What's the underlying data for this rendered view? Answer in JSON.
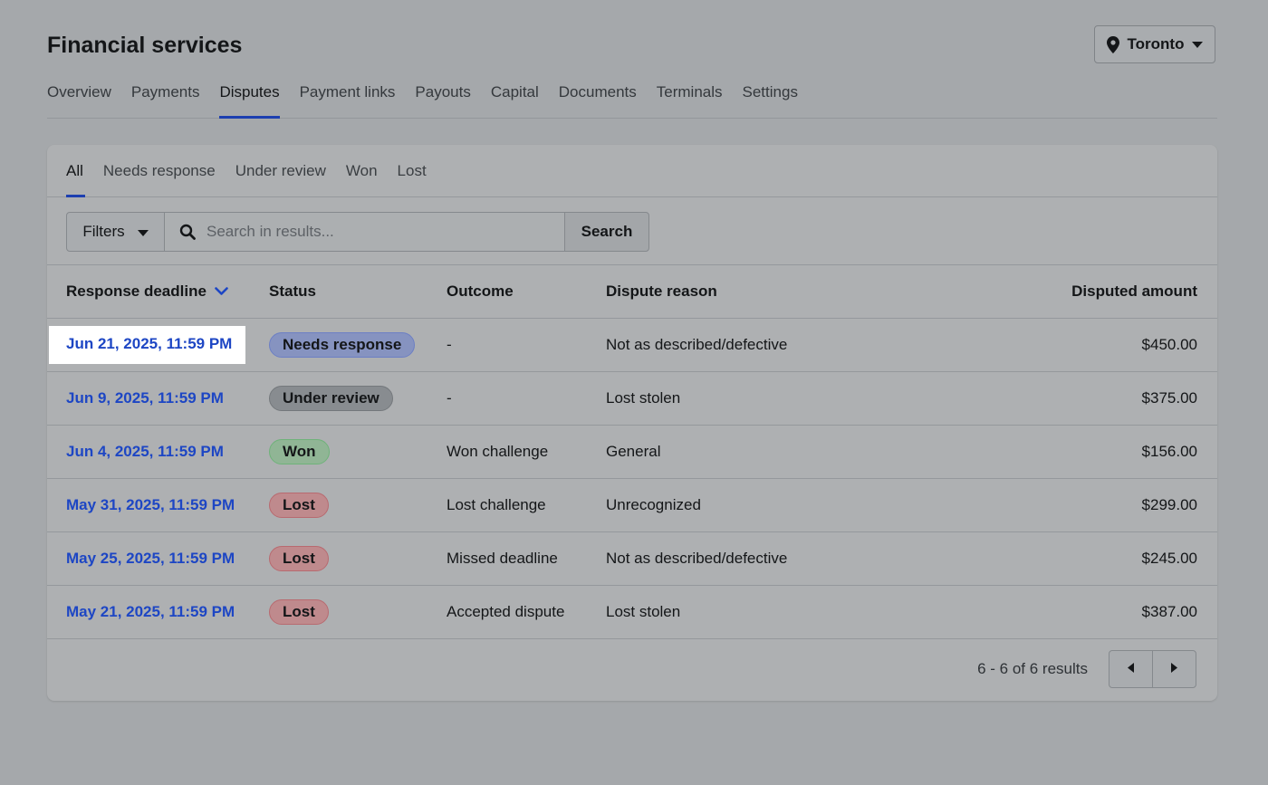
{
  "header": {
    "title": "Financial services",
    "location": "Toronto"
  },
  "nav": {
    "items": [
      "Overview",
      "Payments",
      "Disputes",
      "Payment links",
      "Payouts",
      "Capital",
      "Documents",
      "Terminals",
      "Settings"
    ],
    "active": "Disputes"
  },
  "subtabs": {
    "items": [
      "All",
      "Needs response",
      "Under review",
      "Won",
      "Lost"
    ],
    "active": "All"
  },
  "toolbar": {
    "filters_label": "Filters",
    "search_placeholder": "Search in results...",
    "search_value": "",
    "search_button": "Search"
  },
  "table": {
    "columns": {
      "deadline": "Response deadline",
      "status": "Status",
      "outcome": "Outcome",
      "reason": "Dispute reason",
      "amount": "Disputed amount"
    },
    "rows": [
      {
        "deadline": "Jun 21, 2025, 11:59 PM",
        "status": "Needs response",
        "outcome": "-",
        "reason": "Not as described/defective",
        "amount": "$450.00"
      },
      {
        "deadline": "Jun 9, 2025, 11:59 PM",
        "status": "Under review",
        "outcome": "-",
        "reason": "Lost stolen",
        "amount": "$375.00"
      },
      {
        "deadline": "Jun 4, 2025, 11:59 PM",
        "status": "Won",
        "outcome": "Won challenge",
        "reason": "General",
        "amount": "$156.00"
      },
      {
        "deadline": "May 31, 2025, 11:59 PM",
        "status": "Lost",
        "outcome": "Lost challenge",
        "reason": "Unrecognized",
        "amount": "$299.00"
      },
      {
        "deadline": "May 25, 2025, 11:59 PM",
        "status": "Lost",
        "outcome": "Missed deadline",
        "reason": "Not as described/defective",
        "amount": "$245.00"
      },
      {
        "deadline": "May 21, 2025, 11:59 PM",
        "status": "Lost",
        "outcome": "Accepted dispute",
        "reason": "Lost stolen",
        "amount": "$387.00"
      }
    ]
  },
  "pagination": {
    "summary": "6 - 6 of 6 results"
  },
  "icons": {
    "location": "map-pin-icon",
    "dropdown": "caret-down-icon",
    "search": "search-icon",
    "sort": "chevron-down-icon",
    "prev": "caret-left-icon",
    "next": "caret-right-icon"
  },
  "colors": {
    "accent": "#1d3fb0",
    "link": "#1d46c4"
  }
}
